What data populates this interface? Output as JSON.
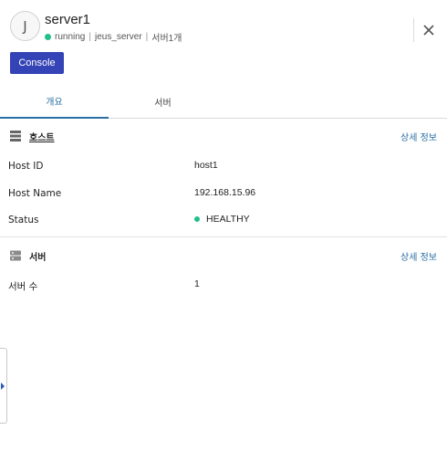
{
  "header": {
    "avatar_letter": "J",
    "title": "server1",
    "status": "running",
    "server_type": "jeus_server",
    "server_count": "서버1개",
    "separator": "|",
    "status_color": "#1fc08a"
  },
  "actions": {
    "console_label": "Console",
    "close_icon": "close-icon"
  },
  "tabs": [
    {
      "label": "개요",
      "active": true
    },
    {
      "label": "서버",
      "active": false
    }
  ],
  "host_section": {
    "title": "호스트",
    "detail_link": "상세 정보",
    "rows": [
      {
        "label": "Host ID",
        "value": "host1"
      },
      {
        "label": "Host Name",
        "value": "192.168.15.96"
      },
      {
        "label": "Status",
        "value": "HEALTHY"
      }
    ]
  },
  "server_section": {
    "title": "서버",
    "detail_link": "상세 정보",
    "rows": [
      {
        "label": "서버 수",
        "value": "1"
      }
    ]
  },
  "colors": {
    "accent": "#2a6fa3",
    "button": "#3443b5",
    "healthy": "#1fc08a"
  }
}
